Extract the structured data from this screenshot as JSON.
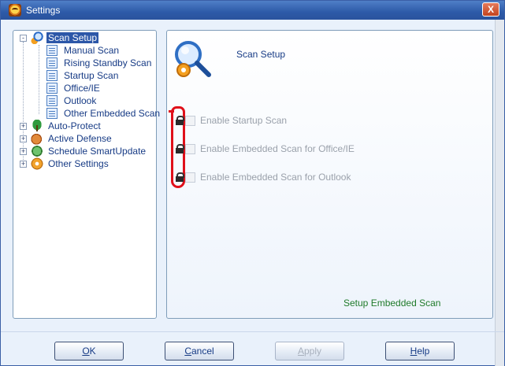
{
  "window": {
    "title": "Settings",
    "close_label": "X"
  },
  "tree": {
    "root": {
      "label": "Scan Setup",
      "expander": "-"
    },
    "scan_children": [
      {
        "label": "Manual Scan"
      },
      {
        "label": "Rising Standby Scan"
      },
      {
        "label": "Startup Scan"
      },
      {
        "label": "Office/IE"
      },
      {
        "label": "Outlook"
      },
      {
        "label": "Other Embedded Scan"
      }
    ],
    "categories": [
      {
        "label": "Auto-Protect",
        "expander": "+"
      },
      {
        "label": "Active Defense",
        "expander": "+"
      },
      {
        "label": "Schedule SmartUpdate",
        "expander": "+"
      },
      {
        "label": "Other Settings",
        "expander": "+"
      }
    ]
  },
  "main": {
    "section_title": "Scan Setup",
    "options": [
      {
        "label": "Enable Startup Scan",
        "checked": false,
        "locked": true
      },
      {
        "label": "Enable Embedded Scan for Office/IE",
        "checked": false,
        "locked": true
      },
      {
        "label": "Enable Embedded Scan for Outlook",
        "checked": false,
        "locked": true
      }
    ],
    "setup_link": "Setup Embedded Scan"
  },
  "buttons": {
    "ok": {
      "mnemonic": "O",
      "rest": "K"
    },
    "cancel": {
      "mnemonic": "C",
      "rest": "ancel"
    },
    "apply": {
      "mnemonic": "A",
      "rest": "pply"
    },
    "help": {
      "mnemonic": "H",
      "rest": "elp"
    }
  },
  "colors": {
    "accent": "#2c57a8",
    "link_green": "#1f7a2a",
    "annotation_red": "#e0101a"
  }
}
